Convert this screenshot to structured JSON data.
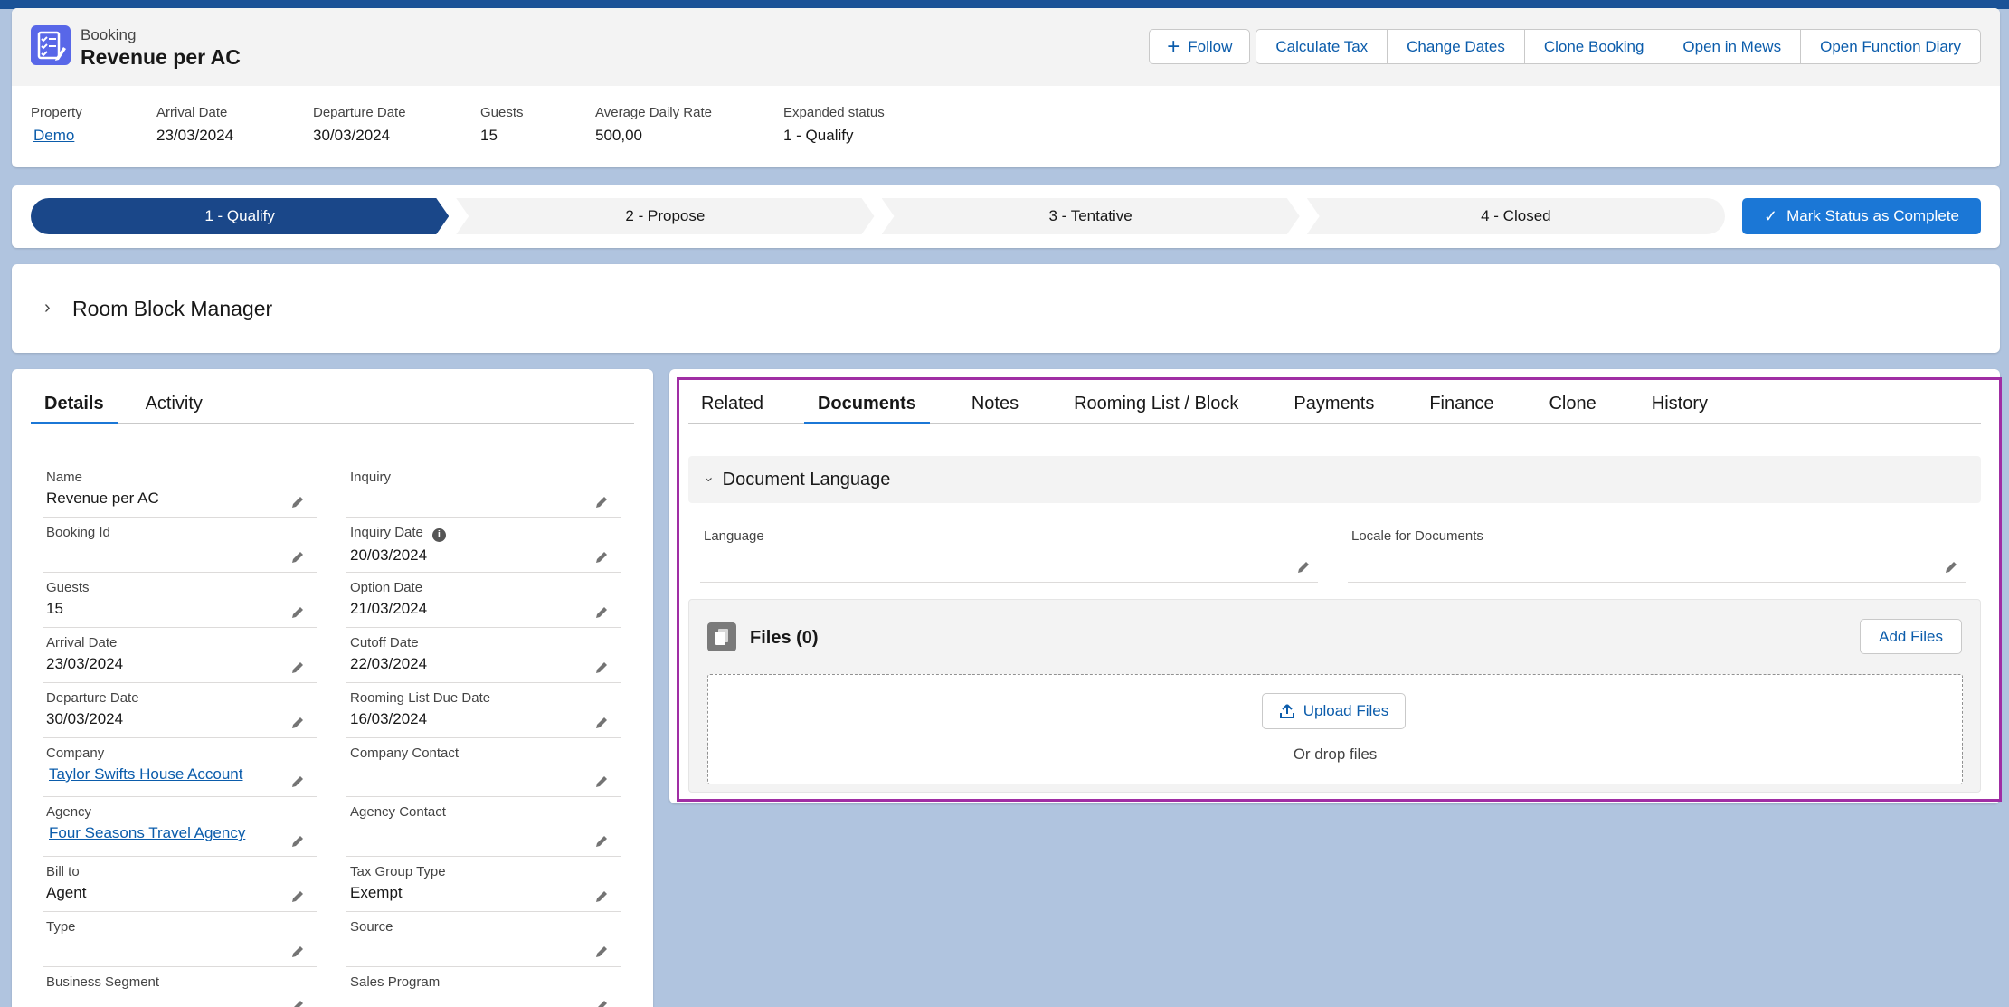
{
  "header": {
    "object_type": "Booking",
    "title": "Revenue per AC",
    "actions": {
      "follow": "Follow",
      "buttons": [
        "Calculate Tax",
        "Change Dates",
        "Clone Booking",
        "Open in Mews",
        "Open Function Diary"
      ]
    },
    "highlights": [
      {
        "label": "Property",
        "value": "Demo"
      },
      {
        "label": "Arrival Date",
        "value": "23/03/2024"
      },
      {
        "label": "Departure Date",
        "value": "30/03/2024"
      },
      {
        "label": "Guests",
        "value": "15"
      },
      {
        "label": "Average Daily Rate",
        "value": "500,00"
      },
      {
        "label": "Expanded status",
        "value": "1 - Qualify"
      }
    ]
  },
  "path": {
    "stages": [
      "1 - Qualify",
      "2 - Propose",
      "3 - Tentative",
      "4 - Closed"
    ],
    "active": "1 - Qualify",
    "mark_button": "Mark Status as Complete"
  },
  "room_block": {
    "title": "Room Block Manager"
  },
  "details": {
    "tabs": [
      "Details",
      "Activity"
    ],
    "rows": [
      [
        {
          "label": "Name",
          "value": "Revenue per AC"
        },
        {
          "label": "Inquiry",
          "value": ""
        }
      ],
      [
        {
          "label": "Booking Id",
          "value": ""
        },
        {
          "label": "Inquiry Date",
          "value": "20/03/2024"
        }
      ],
      [
        {
          "label": "Guests",
          "value": "15"
        },
        {
          "label": "Option Date",
          "value": "21/03/2024"
        }
      ],
      [
        {
          "label": "Arrival Date",
          "value": "23/03/2024"
        },
        {
          "label": "Cutoff Date",
          "value": "22/03/2024"
        }
      ],
      [
        {
          "label": "Departure Date",
          "value": "30/03/2024"
        },
        {
          "label": "Rooming List Due Date",
          "value": "16/03/2024"
        }
      ],
      [
        {
          "label": "Company",
          "value": "Taylor Swifts House Account"
        },
        {
          "label": "Company Contact",
          "value": ""
        }
      ],
      [
        {
          "label": "Agency",
          "value": "Four Seasons Travel Agency"
        },
        {
          "label": "Agency Contact",
          "value": ""
        }
      ],
      [
        {
          "label": "Bill to",
          "value": "Agent"
        },
        {
          "label": "Tax Group Type",
          "value": "Exempt"
        }
      ],
      [
        {
          "label": "Type",
          "value": ""
        },
        {
          "label": "Source",
          "value": ""
        }
      ],
      [
        {
          "label": "Business Segment",
          "value": ""
        },
        {
          "label": "Sales Program",
          "value": ""
        }
      ]
    ]
  },
  "documents": {
    "tabs": [
      "Related",
      "Documents",
      "Notes",
      "Rooming List / Block",
      "Payments",
      "Finance",
      "Clone",
      "History"
    ],
    "active_tab": "Documents",
    "section_title": "Document Language",
    "fields": [
      {
        "label": "Language",
        "value": ""
      },
      {
        "label": "Locale for Documents",
        "value": ""
      }
    ],
    "files": {
      "title": "Files (0)",
      "add_button": "Add Files",
      "upload_button": "Upload Files",
      "drop_text": "Or drop files"
    }
  },
  "colors": {
    "brand": "#1b5297",
    "active_stage": "#1a4789",
    "primary_button": "#1b77d6",
    "link": "#0b5cab",
    "highlight_border": "#a02ea4",
    "object_icon": "#5867e8"
  }
}
